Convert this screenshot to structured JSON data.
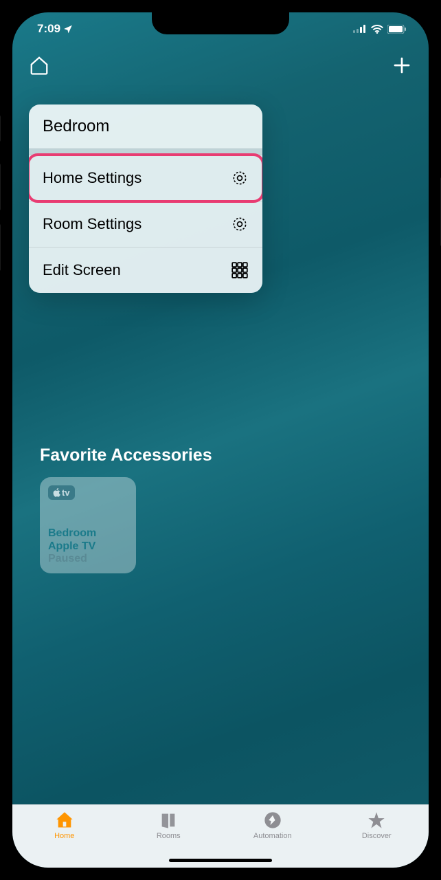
{
  "status": {
    "time": "7:09",
    "location_icon": "location-arrow"
  },
  "menu": {
    "header": "Bedroom",
    "items": [
      {
        "label": "Home Settings",
        "icon": "gear",
        "highlighted": true
      },
      {
        "label": "Room Settings",
        "icon": "gear",
        "highlighted": false
      },
      {
        "label": "Edit Screen",
        "icon": "grid",
        "highlighted": false
      }
    ]
  },
  "section": {
    "title": "Favorite Accessories"
  },
  "accessory": {
    "badge_label": "tv",
    "line1": "Bedroom",
    "line2": "Apple TV",
    "status": "Paused"
  },
  "tabs": [
    {
      "label": "Home",
      "active": true
    },
    {
      "label": "Rooms",
      "active": false
    },
    {
      "label": "Automation",
      "active": false
    },
    {
      "label": "Discover",
      "active": false
    }
  ]
}
